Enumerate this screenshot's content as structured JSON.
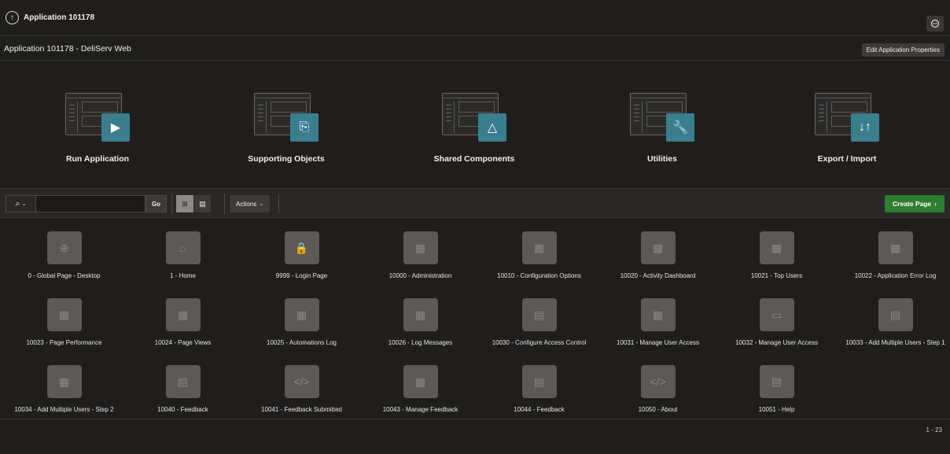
{
  "header": {
    "app_title": "Application 101178",
    "feedback_icon": "feedback-icon",
    "up_icon": "up-arrow-icon"
  },
  "subheader": {
    "page_title": "Application 101178 - DeliServ Web",
    "edit_button": "Edit Application Properties"
  },
  "hero": [
    {
      "label": "Run Application",
      "icon": "play-icon",
      "glyph": "▶"
    },
    {
      "label": "Supporting Objects",
      "icon": "scroll-icon",
      "glyph": "⎘"
    },
    {
      "label": "Shared Components",
      "icon": "shapes-icon",
      "glyph": "△"
    },
    {
      "label": "Utilities",
      "icon": "wrench-icon",
      "glyph": "🔧"
    },
    {
      "label": "Export / Import",
      "icon": "up-down-arrows-icon",
      "glyph": "↓↑"
    }
  ],
  "toolbar": {
    "search_icon": "search-icon",
    "search_value": "",
    "go_label": "Go",
    "actions_label": "Actions",
    "create_page_label": "Create Page"
  },
  "pages": [
    {
      "label": "0 - Global Page - Desktop",
      "icon": "globe-icon",
      "glyph": "⊕"
    },
    {
      "label": "1 - Home",
      "icon": "home-icon",
      "glyph": "⌂"
    },
    {
      "label": "9999 - Login Page",
      "icon": "lock-icon",
      "glyph": "🔒"
    },
    {
      "label": "10000 - Administration",
      "icon": "grid-icon",
      "glyph": "▦"
    },
    {
      "label": "10010 - Configuration Options",
      "icon": "grid-cursor-icon",
      "glyph": "▦"
    },
    {
      "label": "10020 - Activity Dashboard",
      "icon": "grid-icon",
      "glyph": "▦"
    },
    {
      "label": "10021 - Top Users",
      "icon": "grid-cursor-icon",
      "glyph": "▦"
    },
    {
      "label": "10022 - Application Error Log",
      "icon": "grid-cursor-icon",
      "glyph": "▦"
    },
    {
      "label": "10023 - Page Performance",
      "icon": "grid-cursor-icon",
      "glyph": "▦"
    },
    {
      "label": "10024 - Page Views",
      "icon": "grid-cursor-icon",
      "glyph": "▦"
    },
    {
      "label": "10025 - Automations Log",
      "icon": "grid-cursor-icon",
      "glyph": "▦"
    },
    {
      "label": "10026 - Log Messages",
      "icon": "grid-icon",
      "glyph": "▦"
    },
    {
      "label": "10030 - Configure Access Control",
      "icon": "form-icon",
      "glyph": "▤"
    },
    {
      "label": "10031 - Manage User Access",
      "icon": "grid-cursor-icon",
      "glyph": "▦"
    },
    {
      "label": "10032 - Manage User Access",
      "icon": "window-icon",
      "glyph": "▭"
    },
    {
      "label": "10033 - Add Multiple Users - Step 1",
      "icon": "form-icon",
      "glyph": "▤"
    },
    {
      "label": "10034 - Add Multiple Users - Step 2",
      "icon": "grid-icon",
      "glyph": "▦"
    },
    {
      "label": "10040 - Feedback",
      "icon": "form-icon",
      "glyph": "▤"
    },
    {
      "label": "10041 - Feedback Submitted",
      "icon": "code-icon",
      "glyph": "</>"
    },
    {
      "label": "10043 - Manage Feedback",
      "icon": "grid-cursor-icon",
      "glyph": "▦"
    },
    {
      "label": "10044 - Feedback",
      "icon": "form-icon",
      "glyph": "▤"
    },
    {
      "label": "10050 - About",
      "icon": "code-icon",
      "glyph": "</>"
    },
    {
      "label": "10051 - Help",
      "icon": "form-icon",
      "glyph": "▤"
    }
  ],
  "pagination": "1 - 23",
  "colors": {
    "background": "#1f1e1d",
    "accent": "#3a7d8f",
    "create_button": "#2e7d32",
    "tile": "#5c5957"
  }
}
